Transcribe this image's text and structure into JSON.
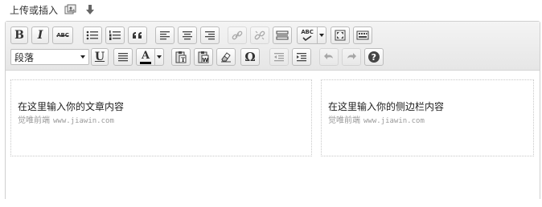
{
  "media": {
    "label": "上传或插入"
  },
  "toolbar": {
    "bold": "B",
    "italic": "I",
    "strikethrough": "ABC",
    "spellcheck": "ABC",
    "underline": "U",
    "text_color": "A",
    "special_char": "Ω",
    "format_select": "段落"
  },
  "content": {
    "main": {
      "heading": "在这里输入你的文章内容",
      "site": "觉唯前端",
      "url": "www.jiawin.com"
    },
    "sidebar": {
      "heading": "在这里输入你的侧边栏内容",
      "site": "觉唯前端",
      "url": "www.jiawin.com"
    }
  }
}
